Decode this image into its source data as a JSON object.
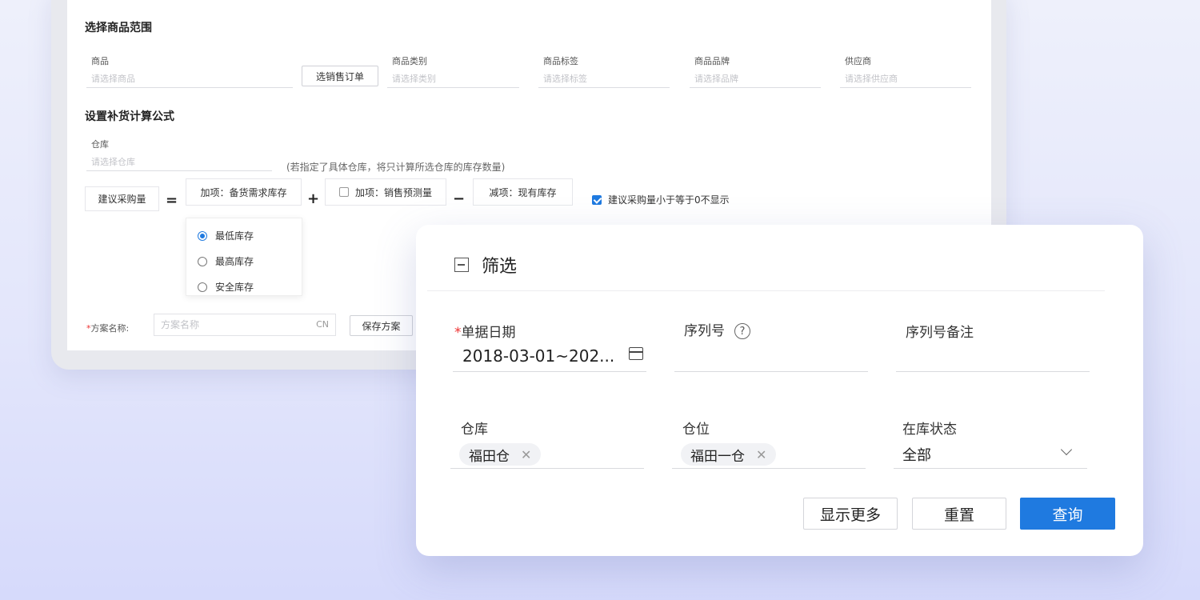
{
  "back": {
    "product_range_title": "选择商品范围",
    "fields": [
      {
        "label": "商品",
        "placeholder": "请选择商品"
      },
      {
        "label": "商品类别",
        "placeholder": "请选择类别"
      },
      {
        "label": "商品标签",
        "placeholder": "请选择标签"
      },
      {
        "label": "商品品牌",
        "placeholder": "请选择品牌"
      },
      {
        "label": "供应商",
        "placeholder": "请选择供应商"
      }
    ],
    "select_order_button": "选销售订单",
    "formula_title": "设置补货计算公式",
    "warehouse_label": "仓库",
    "warehouse_placeholder": "请选择仓库",
    "warehouse_hint": "(若指定了具体仓库，将只计算所选仓库的库存数量)",
    "suggest_qty": "建议采购量",
    "eq": "=",
    "plus": "+",
    "minus": "−",
    "add_item": "加项：备货需求库存",
    "add_sales": "加项：销售预测量",
    "sub_item": "减项：现有库存",
    "hide_nonpositive": "建议采购量小于等于0不显示",
    "stock_options": [
      "最低库存",
      "最高库存",
      "安全库存"
    ],
    "plan_name_label": "方案名称:",
    "plan_name_placeholder": "方案名称",
    "plan_name_suffix": "CN",
    "save_plan_button": "保存方案"
  },
  "filter": {
    "title": "筛选",
    "doc_date_label": "单据日期",
    "doc_date_value": "2018-03-01~202...",
    "serial_label": "序列号",
    "serial_help": "?",
    "serial_note_label": "序列号备注",
    "warehouse_label": "仓库",
    "warehouse_tag": "福田仓",
    "location_label": "仓位",
    "location_tag": "福田一仓",
    "stock_status_label": "在库状态",
    "stock_status_value": "全部",
    "tag_remove": "✕",
    "required_mark": "*",
    "show_more_button": "显示更多",
    "reset_button": "重置",
    "query_button": "查询"
  }
}
